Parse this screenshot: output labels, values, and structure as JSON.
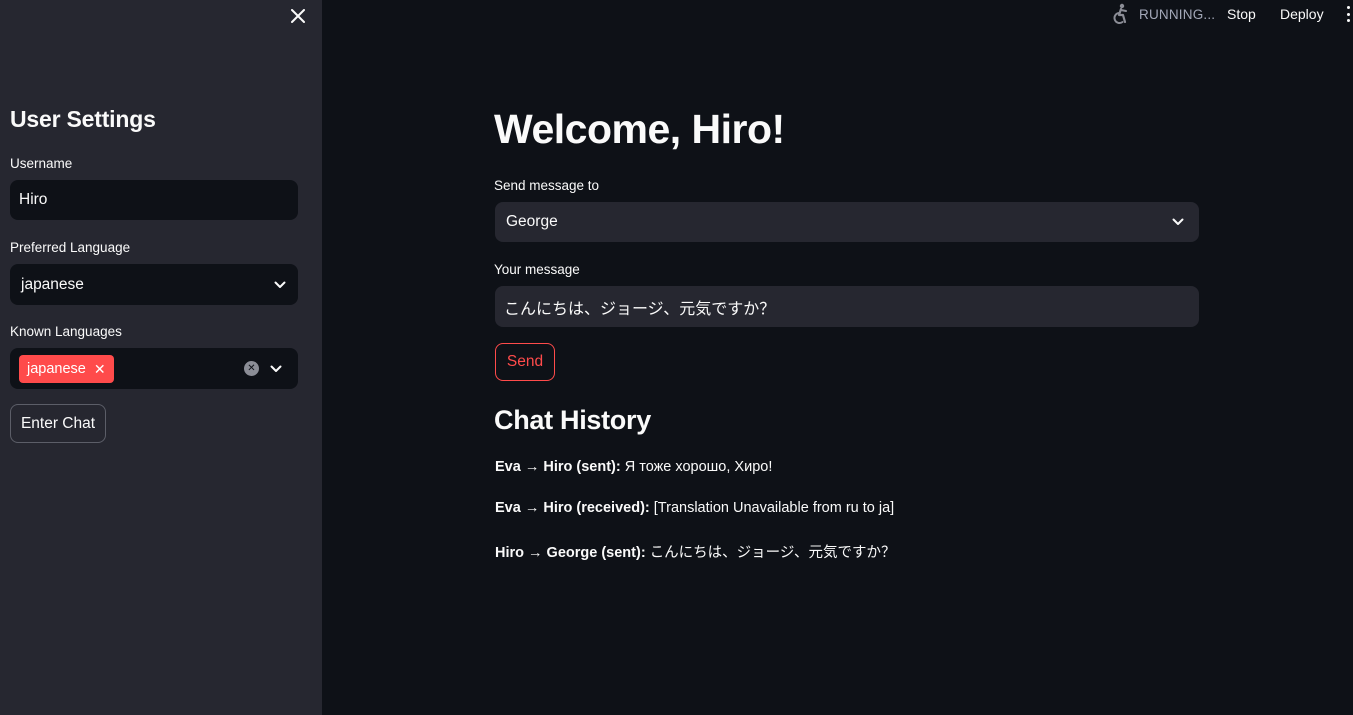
{
  "sidebar": {
    "title": "User Settings",
    "username_label": "Username",
    "username_value": "Hiro",
    "preferred_language_label": "Preferred Language",
    "preferred_language_value": "japanese",
    "known_languages_label": "Known Languages",
    "known_languages": [
      "japanese"
    ],
    "enter_chat_label": "Enter Chat"
  },
  "toolbar": {
    "status": "RUNNING...",
    "stop_label": "Stop",
    "deploy_label": "Deploy"
  },
  "main": {
    "welcome": "Welcome, Hiro!",
    "recipient_label": "Send message to",
    "recipient_value": "George",
    "message_label": "Your message",
    "message_value": "こんにちは、ジョージ、元気ですか？",
    "send_label": "Send",
    "history_title": "Chat History",
    "history": [
      {
        "header": "Eva → Hiro (sent):",
        "text": "Я тоже хорошо, Хиро!"
      },
      {
        "header": "Eva → Hiro (received):",
        "text": "[Translation Unavailable from ru to ja]"
      },
      {
        "header": "Hiro → George (sent):",
        "text": "こんにちは、ジョージ、元気ですか？"
      }
    ]
  },
  "colors": {
    "background": "#0e1117",
    "sidebar": "#262730",
    "accent": "#ff4b4b",
    "text": "#fafafa"
  },
  "icons": [
    "close-icon",
    "chevron-down-icon",
    "running-person-icon",
    "clear-circle-icon",
    "tag-remove-icon",
    "menu-dots-icon"
  ]
}
